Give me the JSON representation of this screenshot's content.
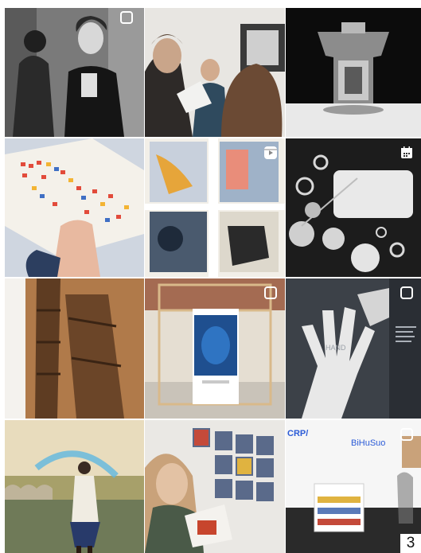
{
  "feed": {
    "posts": [
      {
        "subject": "Woman in black blazer, black-and-white street portrait",
        "badge": "carousel-icon"
      },
      {
        "subject": "Visitors looking at a photobook",
        "badge": ""
      },
      {
        "subject": "Glass object on white surface, black background",
        "badge": ""
      },
      {
        "subject": "Hand holding an open book with colorful swatches",
        "badge": ""
      },
      {
        "subject": "Window panes with colored photographic prints",
        "badge": "reels-icon"
      },
      {
        "subject": "Photogram of circles and rings",
        "badge": "calendar-icon"
      },
      {
        "subject": "Wooden industrial tower photographed on wood",
        "badge": ""
      },
      {
        "subject": "Exhibition pavilion with blue screen installation",
        "badge": "carousel-icon"
      },
      {
        "subject": "Photogram of hands with text panel",
        "badge": "carousel-icon"
      },
      {
        "subject": "Woman in white coat by a river",
        "badge": ""
      },
      {
        "subject": "Woman reading a book in front of a print wall",
        "badge": ""
      },
      {
        "subject": "Gallery booth with book table",
        "badge": "carousel-icon"
      }
    ],
    "booth_sign_left": "CRP/",
    "booth_sign_right": "BiHuSuo",
    "panel_text": "HAND"
  },
  "page_indicator": "3",
  "colors": {
    "background": "#ffffff",
    "badge": "#ffffff",
    "screen_blue": "#1f4f8f",
    "booth_blue": "#2b5bd7"
  }
}
